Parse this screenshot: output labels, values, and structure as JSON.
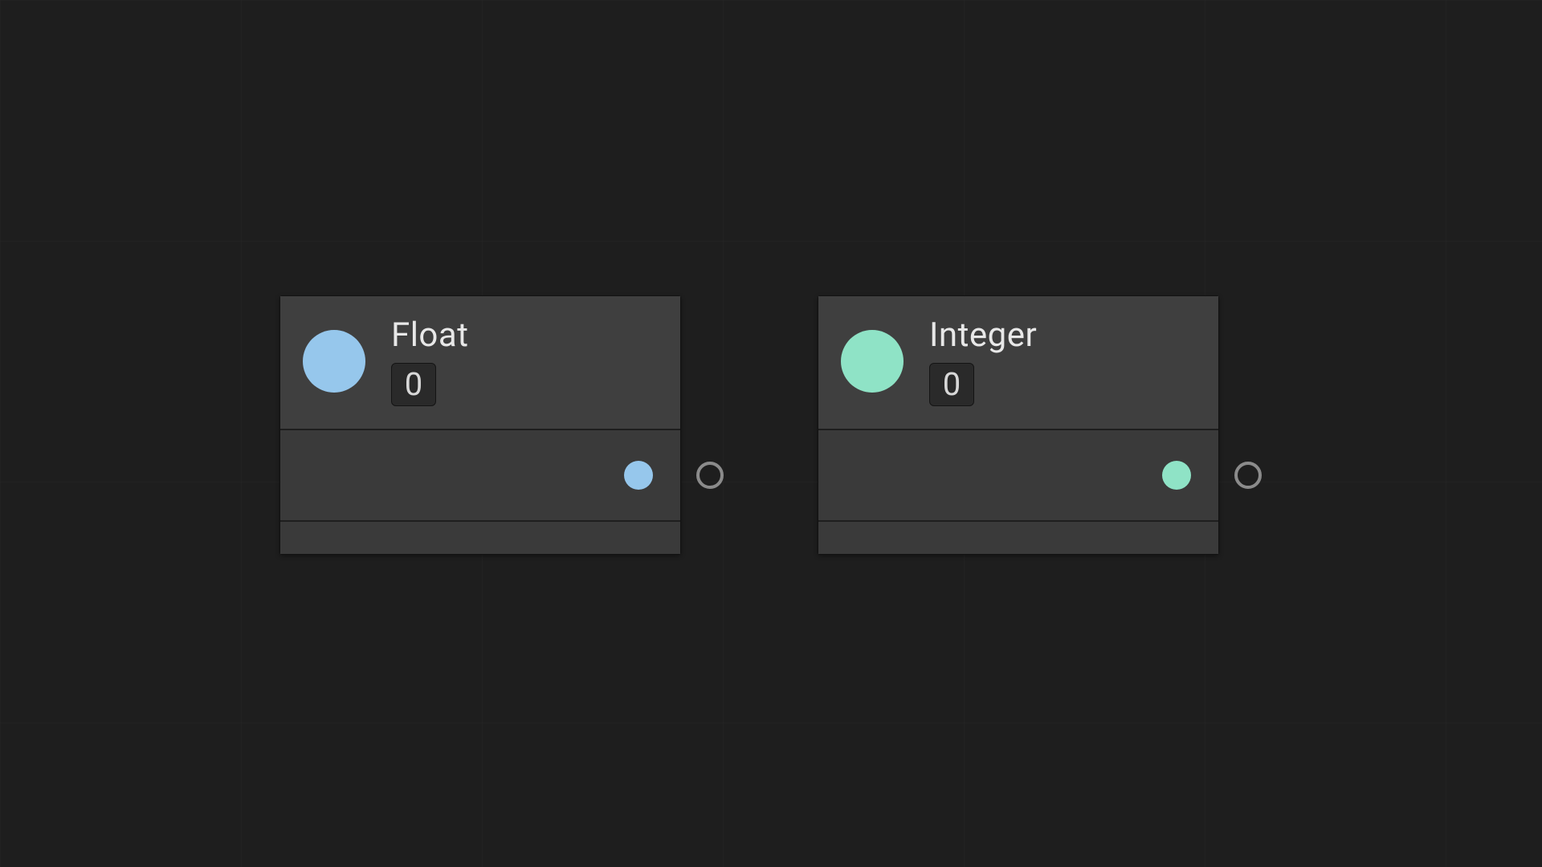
{
  "nodes": {
    "float": {
      "title": "Float",
      "value": "0",
      "type_color": "#96c7ec"
    },
    "integer": {
      "title": "Integer",
      "value": "0",
      "type_color": "#8fe3c6"
    }
  }
}
